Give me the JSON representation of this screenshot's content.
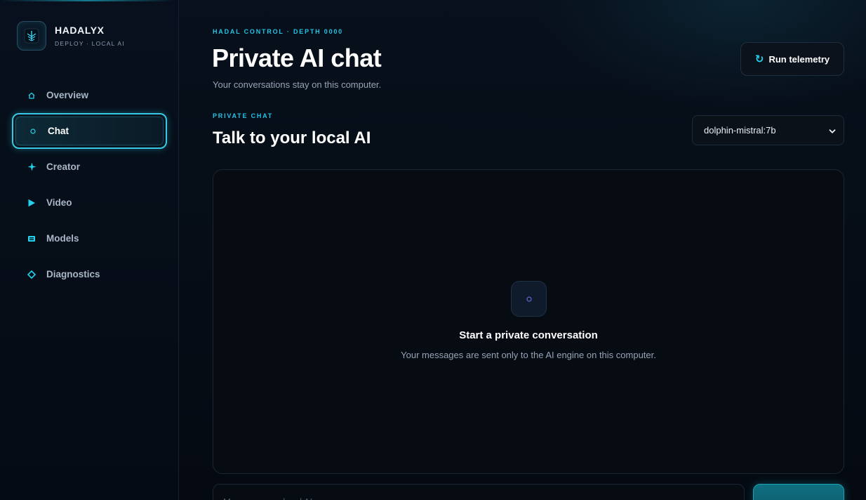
{
  "brand": {
    "name": "HADALYX",
    "subtitle": "DEPLOY · LOCAL AI"
  },
  "sidebar": {
    "items": [
      {
        "label": "Overview",
        "icon": "home-icon",
        "active": false
      },
      {
        "label": "Chat",
        "icon": "circle-icon",
        "active": true
      },
      {
        "label": "Creator",
        "icon": "sparkle-icon",
        "active": false
      },
      {
        "label": "Video",
        "icon": "play-icon",
        "active": false
      },
      {
        "label": "Models",
        "icon": "model-box-icon",
        "active": false
      },
      {
        "label": "Diagnostics",
        "icon": "diamond-icon",
        "active": false
      }
    ]
  },
  "header": {
    "eyebrow": "HADAL CONTROL · DEPTH 0000",
    "title": "Private AI chat",
    "subtitle": "Your conversations stay on this computer.",
    "telemetry_label": "Run telemetry"
  },
  "chat": {
    "eyebrow": "PRIVATE CHAT",
    "title": "Talk to your local AI",
    "model_value": "dolphin-mistral:7b",
    "empty_title": "Start a private conversation",
    "empty_desc": "Your messages are sent only to the AI engine on this computer."
  },
  "composer": {
    "placeholder": "Message your local AI..."
  },
  "colors": {
    "accent": "#22d3ee",
    "background": "#060b14",
    "panel": "#070b12"
  }
}
